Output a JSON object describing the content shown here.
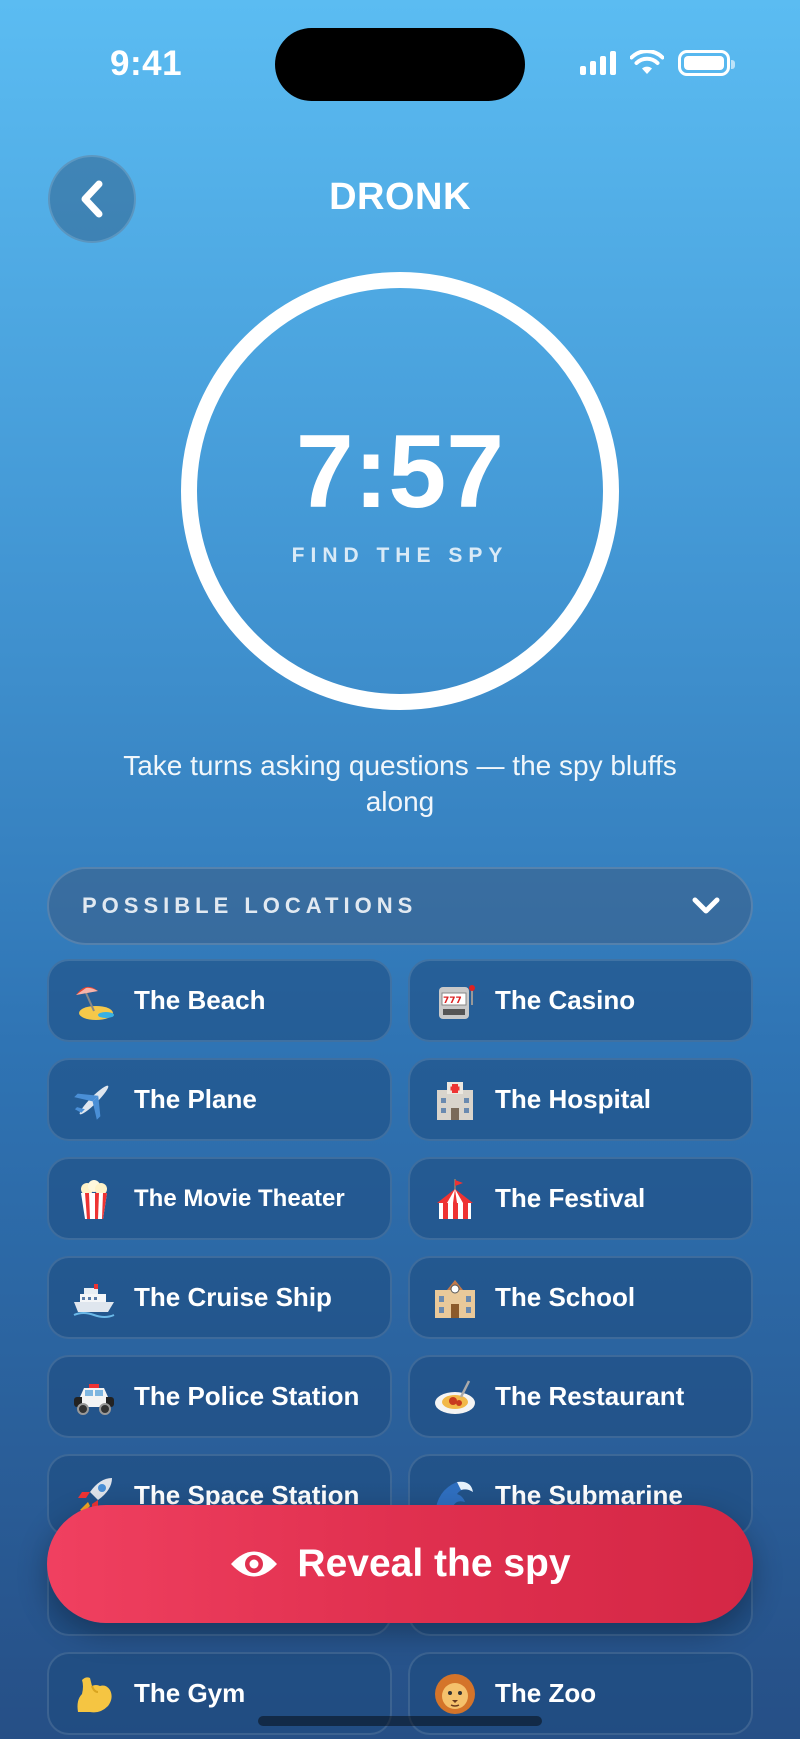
{
  "status_bar": {
    "time": "9:41"
  },
  "header": {
    "title": "DRONK",
    "back_icon": "chevron-left-icon"
  },
  "timer": {
    "value": "7:57",
    "caption": "FIND THE SPY"
  },
  "instructions": "Take turns asking questions — the spy bluffs along",
  "locations": {
    "header_label": "POSSIBLE LOCATIONS",
    "toggle_icon": "chevron-down-icon",
    "items": [
      {
        "label": "The Beach",
        "icon": "beach-umbrella-icon"
      },
      {
        "label": "The Casino",
        "icon": "slot-machine-icon"
      },
      {
        "label": "The Plane",
        "icon": "airplane-icon"
      },
      {
        "label": "The Hospital",
        "icon": "hospital-icon"
      },
      {
        "label": "The Movie Theater",
        "icon": "popcorn-icon"
      },
      {
        "label": "The Festival",
        "icon": "circus-tent-icon"
      },
      {
        "label": "The Cruise Ship",
        "icon": "ship-icon"
      },
      {
        "label": "The School",
        "icon": "school-icon"
      },
      {
        "label": "The Police Station",
        "icon": "police-car-icon"
      },
      {
        "label": "The Restaurant",
        "icon": "spaghetti-icon"
      },
      {
        "label": "The Space Station",
        "icon": "rocket-icon"
      },
      {
        "label": "The Submarine",
        "icon": "wave-icon"
      },
      {
        "label": "",
        "icon": ""
      },
      {
        "label": "",
        "icon": ""
      },
      {
        "label": "The Gym",
        "icon": "flexed-biceps-icon"
      },
      {
        "label": "The Zoo",
        "icon": "lion-icon"
      }
    ]
  },
  "reveal_button": {
    "label": "Reveal the spy",
    "icon": "eye-icon"
  },
  "colors": {
    "reveal": "#e0304f",
    "card": "#1e4b7d"
  }
}
